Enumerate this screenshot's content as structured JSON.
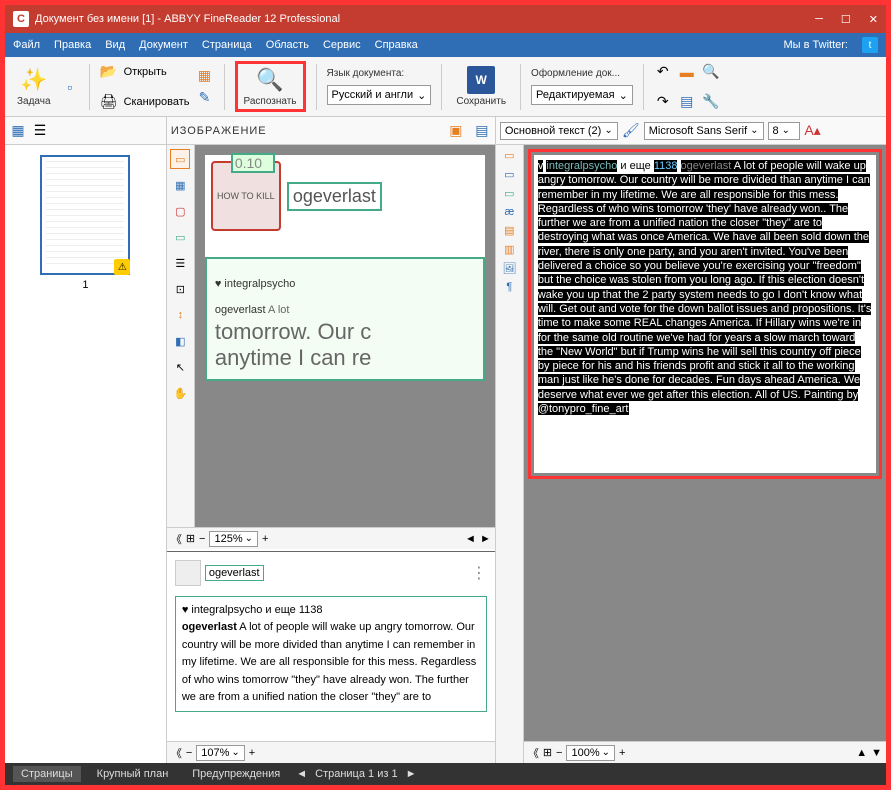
{
  "title": "Документ без имени [1] - ABBYY FineReader 12 Professional",
  "menu": {
    "file": "Файл",
    "edit": "Правка",
    "view": "Вид",
    "doc": "Документ",
    "page": "Страница",
    "area": "Область",
    "service": "Сервис",
    "help": "Справка",
    "twitter": "Мы в Twitter:"
  },
  "toolbar": {
    "task": "Задача",
    "open": "Открыть",
    "scan": "Сканировать",
    "recognize": "Распознать",
    "lang_label": "Язык документа:",
    "lang_value": "Русский и англи",
    "save": "Сохранить",
    "format_label": "Оформление док...",
    "format_value": "Редактируемая"
  },
  "image_panel": {
    "title": "ИЗОБРАЖЕНИЕ",
    "zoom": "125%",
    "thumb_num": "1",
    "green_num": "0.10"
  },
  "post": {
    "avatar_txt": "HOW TO KILL",
    "uname": "ogeverlast",
    "line1_a": "integralpsycho",
    "line2_a": "ogeverlast",
    "line2_b": " A lot",
    "line3": "tomorrow. Our c",
    "line4": "anytime I can re"
  },
  "text_panel": {
    "style": "Основной текст (2)",
    "font": "Microsoft Sans Serif",
    "size": "8",
    "zoom": "100%",
    "hdr_v": "v",
    "hdr_user": "integralpsycho",
    "hdr_mid": " и еще ",
    "hdr_num": "1138",
    "hdr_og": " ogeverlast ",
    "body": "A lot of people will wake up angry tomorrow. Our country will be more divided than anytime I can remember in my lifetime. We are all responsible for this mess. Regardless of who wins tomorrow 'they' have already won.. The further we are from a unified nation the closer \"they\" are to destroying what was once America. We have all been sold down the river, there is only one party, and you aren't invited. You've been delivered a choice so you believe you're exercising your \"freedom\" but the choice was stolen from you long ago. If this election doesn't wake you up that the 2 party system needs to go I don't know what will. Get out and vote for the down ballot issues and propositions. It's time to make some REAL changes America. If Hillary wins we're in for the same old routine we've had for years a slow march toward the \"New World\" but if Trump wins he will sell this country off piece by piece for his and his friends profit and stick it all to the working man just like he's done for decades. Fun days ahead America. We deserve what ever we get after this election. All of US. Painting by @tonypro_fine_art"
  },
  "preview": {
    "uname": "ogeverlast",
    "zoom": "107%",
    "hdr": "♥ integralpsycho и еще 1138",
    "bold": "ogeverlast",
    "body": " A lot of people will wake up angry tomorrow. Our country will be more divided than anytime I can remember in my lifetime. We are all responsible for this mess. Regardless of who wins tomorrow \"they\" have already won. The further we are from a unified nation the closer \"they\" are to"
  },
  "status": {
    "pages": "Страницы",
    "closeup": "Крупный план",
    "warnings": "Предупреждения",
    "page_of": "Страница 1 из 1"
  }
}
